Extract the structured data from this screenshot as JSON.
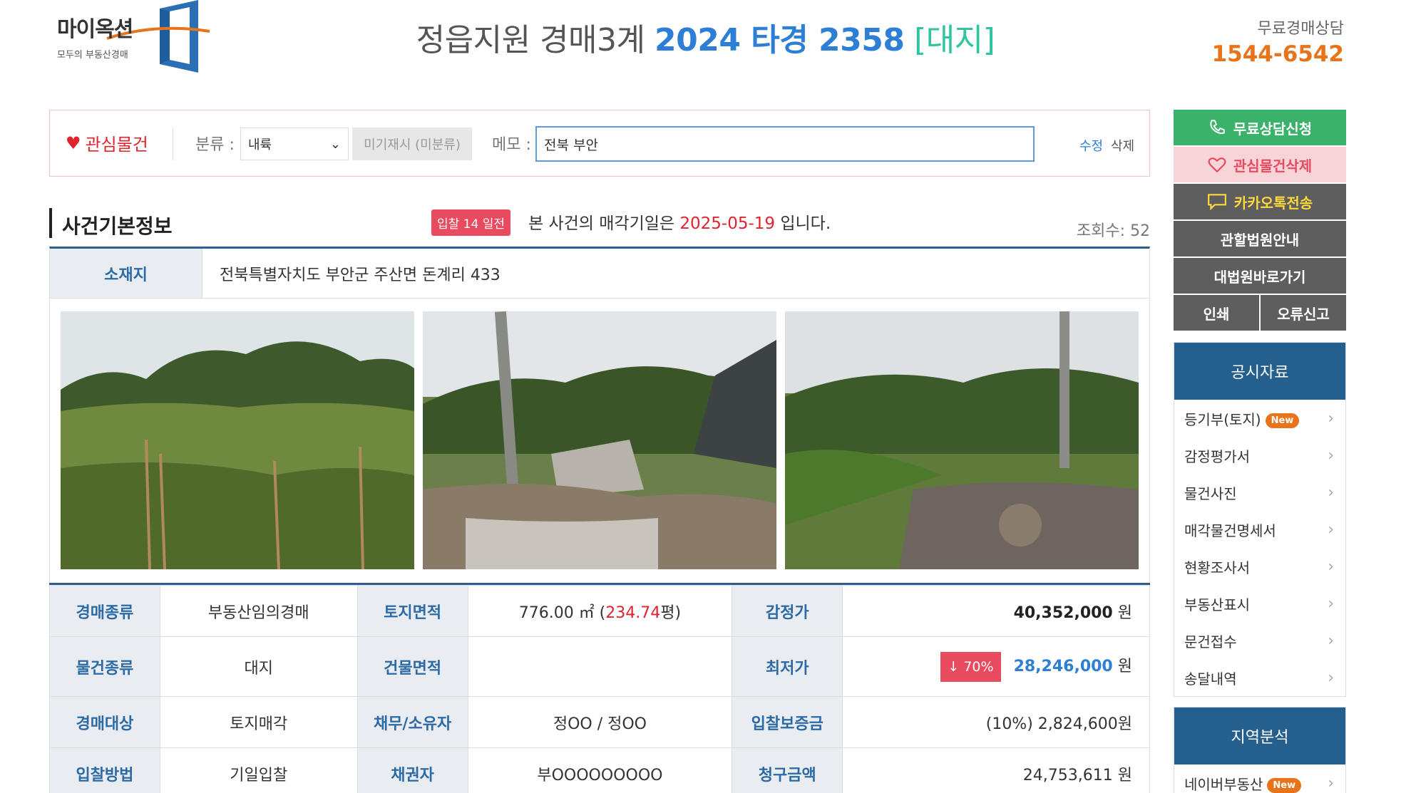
{
  "header": {
    "logo_text": "마이옥션",
    "logo_sub": "모두의 부동산경매",
    "title_court": "정읍지원 경매3계",
    "title_case": "2024 타경 2358",
    "title_kind": "[대지]",
    "contact_label": "무료경매상담",
    "contact_phone": "1544-6542"
  },
  "interest": {
    "fav_label": "관심물건",
    "category_label": "분류 :",
    "category_value": "내륙",
    "category_tag": "미기재시 (미분류)",
    "memo_label": "메모 :",
    "memo_value": "전북 부안",
    "edit_label": "수정",
    "delete_label": "삭제"
  },
  "section": {
    "title": "사건기본정보",
    "badge": "입찰 14 일전",
    "notice_prefix": "본 사건의 매각기일은 ",
    "notice_date": "2025-05-19",
    "notice_suffix": " 입니다.",
    "views": "조회수: 52"
  },
  "address": {
    "label": "소재지",
    "value": "전북특별자치도 부안군 주산면 돈계리 433"
  },
  "info": {
    "r1": {
      "h1": "경매종류",
      "v1": "부동산임의경매",
      "h2": "토지면적",
      "v2a": "776.00 ㎡ (",
      "v2b": "234.74",
      "v2c": "평)",
      "h3": "감정가",
      "v3": "40,352,000",
      "unit": "원"
    },
    "r2": {
      "h1": "물건종류",
      "v1": "대지",
      "h2": "건물면적",
      "v2": "",
      "h3": "최저가",
      "rate": "↓ 70%",
      "v3": "28,246,000",
      "unit": "원"
    },
    "r3": {
      "h1": "경매대상",
      "v1": "토지매각",
      "h2": "채무/소유자",
      "v2": "정OO / 정OO",
      "h3": "입찰보증금",
      "v3": "(10%) 2,824,600원"
    },
    "r4": {
      "h1": "입찰방법",
      "v1": "기일입찰",
      "h2": "채권자",
      "v2": "부OOOOOOOOO",
      "h3": "청구금액",
      "v3": "24,753,611 원"
    }
  },
  "sidebar": {
    "consult": "무료상담신청",
    "delete_fav": "관심물건삭제",
    "kakao": "카카오톡전송",
    "court_guide": "관할법원안내",
    "supreme_court": "대법원바로가기",
    "print": "인쇄",
    "report": "오류신고",
    "public_docs": {
      "title": "공시자료",
      "items": [
        "등기부(토지)",
        "감정평가서",
        "물건사진",
        "매각물건명세서",
        "현황조사서",
        "부동산표시",
        "문건접수",
        "송달내역"
      ],
      "new_badge": "New"
    },
    "region": {
      "title": "지역분석",
      "items": [
        "네이버부동산"
      ],
      "new_badge": "New"
    }
  },
  "colors": {
    "accent_blue": "#2d7fd6",
    "brand_orange": "#e8731a",
    "header_navy": "#245f8e",
    "alert_red": "#e84a5f",
    "green": "#3bb26a"
  }
}
